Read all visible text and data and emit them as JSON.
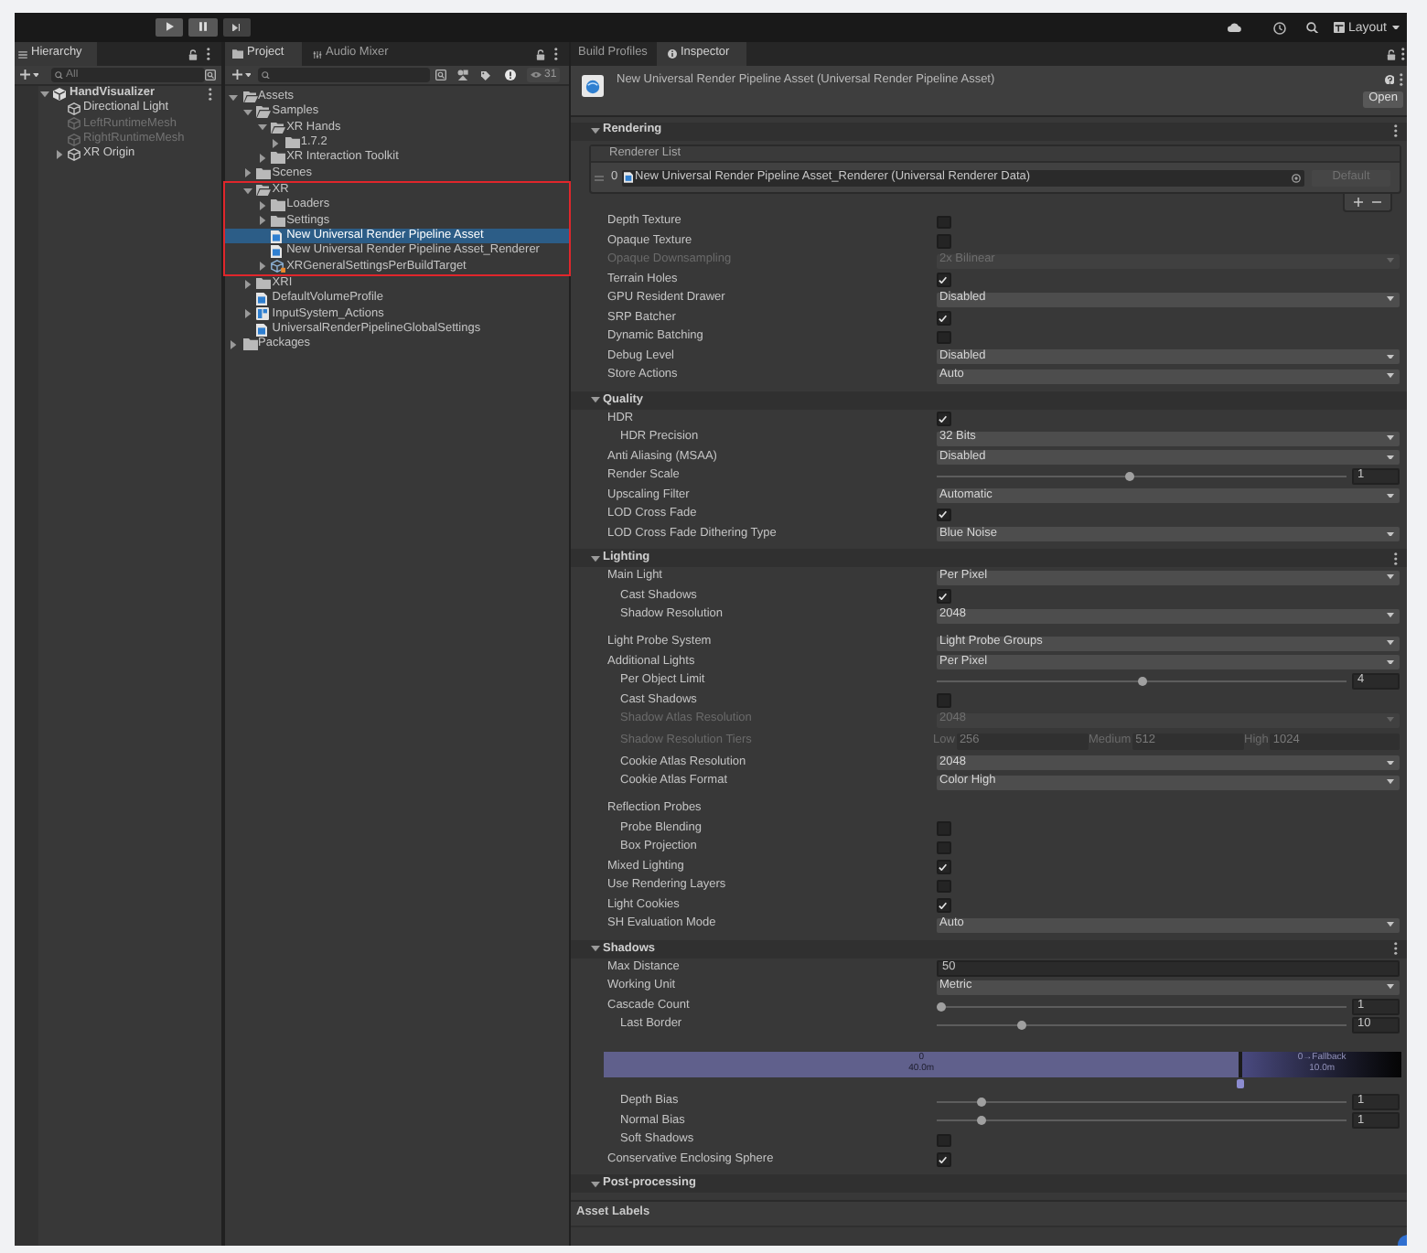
{
  "toolbar": {
    "layout_menu": "Layout"
  },
  "hierarchy": {
    "tab": {
      "label": "Hierarchy",
      "selected": true
    },
    "search": {
      "placeholder": "All"
    },
    "tree": [
      {
        "label": "HandVisualizer",
        "kind": "scene",
        "active": true,
        "expanded": true,
        "children": [
          {
            "label": "Directional Light",
            "kind": "object",
            "active": true
          },
          {
            "label": "LeftRuntimeMesh",
            "kind": "object",
            "active": false
          },
          {
            "label": "RightRuntimeMesh",
            "kind": "object",
            "active": false
          },
          {
            "label": "XR Origin",
            "kind": "object",
            "active": true,
            "expanded": false
          }
        ]
      }
    ]
  },
  "project": {
    "tabs": [
      {
        "label": "Project",
        "selected": true
      },
      {
        "label": "Audio Mixer",
        "selected": false
      }
    ],
    "hidden_count": "31",
    "tree": [
      {
        "label": "Assets",
        "kind": "folder",
        "expanded": true,
        "selected": false,
        "highlighted": false,
        "children": [
          {
            "label": "Samples",
            "kind": "folder",
            "expanded": true,
            "selected": false,
            "highlighted": false,
            "children": [
              {
                "label": "XR Hands",
                "kind": "folder",
                "expanded": true,
                "selected": false,
                "highlighted": false,
                "children": [
                  {
                    "label": "1.7.2",
                    "kind": "folder",
                    "expanded": false,
                    "selected": false,
                    "highlighted": false
                  }
                ]
              },
              {
                "label": "XR Interaction Toolkit",
                "kind": "folder",
                "expanded": false,
                "selected": false,
                "highlighted": false
              }
            ]
          },
          {
            "label": "Scenes",
            "kind": "folder",
            "expanded": false,
            "selected": false,
            "highlighted": false
          },
          {
            "label": "XR",
            "kind": "folder",
            "expanded": true,
            "selected": false,
            "highlighted": true,
            "children": [
              {
                "label": "Loaders",
                "kind": "folder",
                "expanded": false,
                "selected": false,
                "highlighted": false
              },
              {
                "label": "Settings",
                "kind": "folder",
                "expanded": false,
                "selected": false,
                "highlighted": false
              },
              {
                "label": "New Universal Render Pipeline Asset",
                "kind": "asset",
                "selected": true,
                "highlighted": false
              },
              {
                "label": "New Universal Render Pipeline Asset_Renderer",
                "kind": "asset",
                "selected": false,
                "highlighted": false
              },
              {
                "label": "XRGeneralSettingsPerBuildTarget",
                "kind": "settings",
                "expanded": false,
                "selected": false,
                "highlighted": false
              }
            ]
          },
          {
            "label": "XRI",
            "kind": "folder",
            "expanded": false,
            "selected": false,
            "highlighted": false
          },
          {
            "label": "DefaultVolumeProfile",
            "kind": "asset",
            "selected": false,
            "highlighted": false
          },
          {
            "label": "InputSystem_Actions",
            "kind": "input",
            "expanded": false,
            "selected": false,
            "highlighted": false
          },
          {
            "label": "UniversalRenderPipelineGlobalSettings",
            "kind": "asset",
            "selected": false,
            "highlighted": false
          }
        ]
      },
      {
        "label": "Packages",
        "kind": "folder",
        "expanded": false,
        "selected": false,
        "highlighted": false
      }
    ]
  },
  "inspector": {
    "tabs": [
      {
        "label": "Build Profiles",
        "selected": false
      },
      {
        "label": "Inspector",
        "selected": true
      }
    ],
    "header": {
      "title": "New Universal Render Pipeline Asset (Universal Render Pipeline Asset)",
      "open_button": "Open"
    },
    "sections": [
      {
        "title": "Rendering",
        "expanded": true,
        "menu": true,
        "renderer_list": {
          "title": "Renderer List",
          "items": [
            {
              "index": "0",
              "value": "New Universal Render Pipeline Asset_Renderer (Universal Renderer Data)",
              "default_button": {
                "label": "Default",
                "disabled": true
              }
            }
          ]
        },
        "groups": [
          {
            "rows": [
              {
                "kind": "checkbox",
                "label": "Depth Texture",
                "checked": false,
                "disabled": false
              },
              {
                "kind": "checkbox",
                "label": "Opaque Texture",
                "checked": false,
                "disabled": false
              },
              {
                "kind": "dropdown",
                "label": "Opaque Downsampling",
                "value": "2x Bilinear",
                "disabled": true
              },
              {
                "kind": "checkbox",
                "label": "Terrain Holes",
                "checked": true,
                "disabled": false
              },
              {
                "kind": "dropdown",
                "label": "GPU Resident Drawer",
                "value": "Disabled",
                "disabled": false
              },
              {
                "kind": "checkbox",
                "label": "SRP Batcher",
                "checked": true,
                "disabled": false
              },
              {
                "kind": "checkbox",
                "label": "Dynamic Batching",
                "checked": false,
                "disabled": false
              },
              {
                "kind": "dropdown",
                "label": "Debug Level",
                "value": "Disabled",
                "disabled": false
              },
              {
                "kind": "dropdown",
                "label": "Store Actions",
                "value": "Auto",
                "disabled": false
              }
            ]
          }
        ]
      },
      {
        "title": "Quality",
        "expanded": true,
        "menu": false,
        "groups": [
          {
            "rows": [
              {
                "kind": "checkbox",
                "label": "HDR",
                "checked": true,
                "disabled": false,
                "children": [
                  {
                    "kind": "dropdown",
                    "label": "HDR Precision",
                    "value": "32 Bits",
                    "disabled": false
                  }
                ]
              },
              {
                "kind": "dropdown",
                "label": "Anti Aliasing (MSAA)",
                "value": "Disabled",
                "disabled": false
              },
              {
                "kind": "slider",
                "label": "Render Scale",
                "level": 0.47,
                "reading": "1",
                "disabled": false
              },
              {
                "kind": "dropdown",
                "label": "Upscaling Filter",
                "value": "Automatic",
                "disabled": false
              },
              {
                "kind": "checkbox",
                "label": "LOD Cross Fade",
                "checked": true,
                "disabled": false
              },
              {
                "kind": "dropdown",
                "label": "LOD Cross Fade Dithering Type",
                "value": "Blue Noise",
                "disabled": false
              }
            ]
          }
        ]
      },
      {
        "title": "Lighting",
        "expanded": true,
        "menu": true,
        "groups": [
          {
            "rows": [
              {
                "kind": "dropdown",
                "label": "Main Light",
                "value": "Per Pixel",
                "disabled": false,
                "children": [
                  {
                    "kind": "checkbox",
                    "label": "Cast Shadows",
                    "checked": true,
                    "disabled": false
                  },
                  {
                    "kind": "dropdown",
                    "label": "Shadow Resolution",
                    "value": "2048",
                    "disabled": false
                  }
                ]
              }
            ]
          },
          {
            "rows": [
              {
                "kind": "dropdown",
                "label": "Light Probe System",
                "value": "Light Probe Groups",
                "disabled": false
              },
              {
                "kind": "dropdown",
                "label": "Additional Lights",
                "value": "Per Pixel",
                "disabled": false,
                "children": [
                  {
                    "kind": "slider",
                    "label": "Per Object Limit",
                    "level": 0.5,
                    "reading": "4",
                    "disabled": false
                  },
                  {
                    "kind": "checkbox",
                    "label": "Cast Shadows",
                    "checked": false,
                    "disabled": false
                  },
                  {
                    "kind": "dropdown",
                    "label": "Shadow Atlas Resolution",
                    "value": "2048",
                    "disabled": true
                  },
                  {
                    "kind": "tiers",
                    "label": "Shadow Resolution Tiers",
                    "disabled": true,
                    "tiers": [
                      {
                        "label": "Low",
                        "value": "256"
                      },
                      {
                        "label": "Medium",
                        "value": "512"
                      },
                      {
                        "label": "High",
                        "value": "1024"
                      }
                    ]
                  },
                  {
                    "kind": "dropdown",
                    "label": "Cookie Atlas Resolution",
                    "value": "2048",
                    "disabled": false
                  },
                  {
                    "kind": "dropdown",
                    "label": "Cookie Atlas Format",
                    "value": "Color High",
                    "disabled": false
                  }
                ]
              }
            ]
          },
          {
            "rows": [
              {
                "kind": "label",
                "label": "Reflection Probes",
                "disabled": false,
                "children": [
                  {
                    "kind": "checkbox",
                    "label": "Probe Blending",
                    "checked": false,
                    "disabled": false
                  },
                  {
                    "kind": "checkbox",
                    "label": "Box Projection",
                    "checked": false,
                    "disabled": false
                  }
                ]
              },
              {
                "kind": "checkbox",
                "label": "Mixed Lighting",
                "checked": true,
                "disabled": false
              },
              {
                "kind": "checkbox",
                "label": "Use Rendering Layers",
                "checked": false,
                "disabled": false
              },
              {
                "kind": "checkbox",
                "label": "Light Cookies",
                "checked": true,
                "disabled": false
              },
              {
                "kind": "dropdown",
                "label": "SH Evaluation Mode",
                "value": "Auto",
                "disabled": false
              }
            ]
          }
        ]
      },
      {
        "title": "Shadows",
        "expanded": true,
        "menu": true,
        "groups": [
          {
            "rows": [
              {
                "kind": "number",
                "label": "Max Distance",
                "value": "50",
                "disabled": false
              },
              {
                "kind": "dropdown",
                "label": "Working Unit",
                "value": "Metric",
                "disabled": false
              },
              {
                "kind": "slider",
                "label": "Cascade Count",
                "level": 0,
                "reading": "1",
                "disabled": false,
                "children": [
                  {
                    "kind": "slider",
                    "label": "Last Border",
                    "level": 0.2,
                    "reading": "10",
                    "disabled": false
                  },
                  {
                    "kind": "cascade",
                    "level": 0.8,
                    "segments": [
                      {
                        "label": "0",
                        "reading": "40.0m"
                      },
                      {
                        "label": "0→Fallback",
                        "reading": "10.0m"
                      }
                    ]
                  },
                  {
                    "kind": "slider",
                    "label": "Depth Bias",
                    "level": 0.1,
                    "reading": "1",
                    "disabled": false
                  },
                  {
                    "kind": "slider",
                    "label": "Normal Bias",
                    "level": 0.1,
                    "reading": "1",
                    "disabled": false
                  },
                  {
                    "kind": "checkbox",
                    "label": "Soft Shadows",
                    "checked": false,
                    "disabled": false
                  }
                ]
              },
              {
                "kind": "checkbox",
                "label": "Conservative Enclosing Sphere",
                "checked": true,
                "disabled": false
              }
            ]
          }
        ]
      },
      {
        "title": "Post-processing",
        "expanded": true,
        "menu": false
      }
    ],
    "asset_labels": "Asset Labels"
  }
}
